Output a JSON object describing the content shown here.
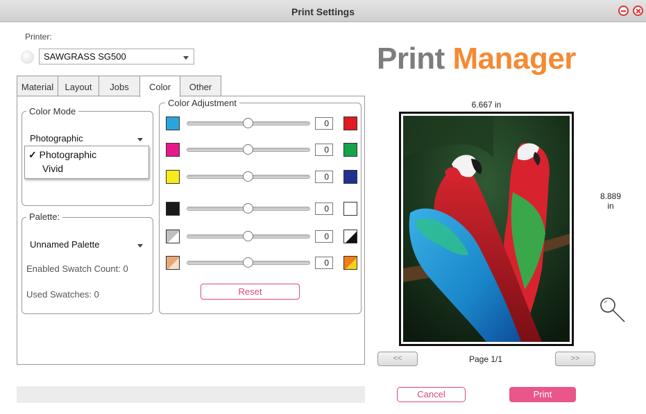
{
  "window": {
    "title": "Print Settings"
  },
  "printer": {
    "label": "Printer:",
    "selected": "SAWGRASS SG500"
  },
  "tabs": [
    {
      "label": "Material"
    },
    {
      "label": "Layout"
    },
    {
      "label": "Jobs"
    },
    {
      "label": "Color",
      "active": true
    },
    {
      "label": "Other"
    }
  ],
  "color_mode": {
    "title": "Color Mode",
    "selected": "Photographic",
    "options": [
      {
        "label": "Photographic",
        "checked": true
      },
      {
        "label": "Vivid",
        "checked": false
      }
    ],
    "checkmark": "✓"
  },
  "palette": {
    "title": "Palette:",
    "selected": "Unnamed Palette",
    "enabled_swatch_count": "Enabled Swatch Count: 0",
    "used_swatches": "Used Swatches: 0"
  },
  "color_adjustment": {
    "title": "Color Adjustment",
    "rows": [
      {
        "left_color": "#2aa4dc",
        "right_color": "#e01b22",
        "value": "0",
        "level": 0.5
      },
      {
        "left_color": "#e6198b",
        "right_color": "#16a34a",
        "value": "0",
        "level": 0.5
      },
      {
        "left_color": "#f7ec1a",
        "right_color": "#22318f",
        "value": "0",
        "level": 0.5
      },
      {
        "left_color": "#1a1a1a",
        "right_color": "#ffffff",
        "value": "0",
        "level": 0.5
      },
      {
        "left_icon": "gray-white-diagonal-icon",
        "right_icon": "black-white-diagonal-icon",
        "value": "0",
        "level": 0.5
      },
      {
        "left_icon": "skin-tone-diagonal-icon",
        "right_icon": "orange-yellow-diagonal-icon",
        "value": "0",
        "level": 0.5
      }
    ],
    "reset_label": "Reset"
  },
  "logo": {
    "part1": "Print",
    "part2": "Manager",
    "color1": "#7d7d7d",
    "color2": "#f58a34"
  },
  "preview": {
    "width_label": "6.667 in",
    "height_value": "8.889",
    "height_unit": "in",
    "page_label": "Page 1/1",
    "prev_label": "<<",
    "next_label": ">>"
  },
  "actions": {
    "cancel_label": "Cancel",
    "print_label": "Print"
  },
  "colors": {
    "accent": "#e0457a"
  }
}
